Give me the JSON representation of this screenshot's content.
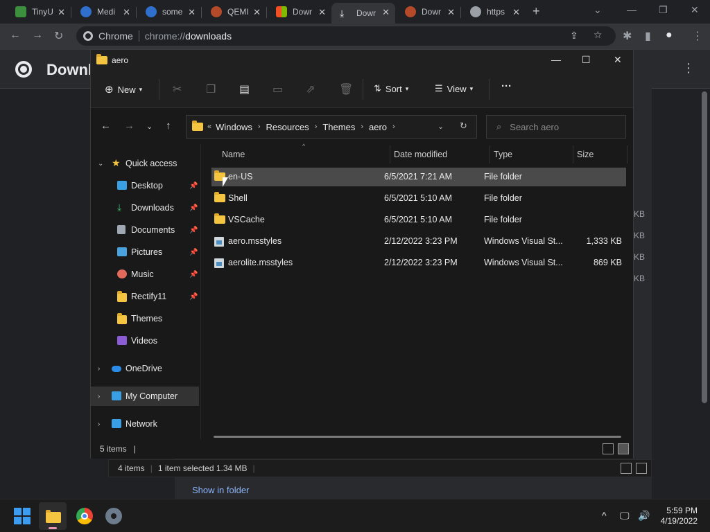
{
  "chrome": {
    "tabs": [
      {
        "title": "TinyU",
        "icon_color": "#3c8f3c"
      },
      {
        "title": "Medi",
        "icon_color": "#2f6fce"
      },
      {
        "title": "some",
        "icon_color": "#2f6fce"
      },
      {
        "title": "QEMI",
        "icon_color": "#b54a2b"
      },
      {
        "title": "Dowr",
        "icon_color": "#e04a2b"
      },
      {
        "title": "Dowr",
        "icon_color": "#e8eaed"
      },
      {
        "title": "Dowr",
        "icon_color": "#b54a2b"
      },
      {
        "title": "https",
        "icon_color": "#9aa0a6"
      }
    ],
    "new_tab": "+",
    "omnibox": {
      "chip": "Chrome",
      "url_scheme": "chrome://",
      "url_path": "downloads"
    }
  },
  "downloads_page": {
    "title": "Downl",
    "sizes": [
      "KB",
      "KB",
      "KB",
      "KB"
    ],
    "show_in_folder": "Show in folder",
    "behind_status": {
      "items": "4 items",
      "selected": "1 item selected  1.34 MB"
    }
  },
  "explorer": {
    "title": "aero",
    "toolbar": {
      "new": "New",
      "sort": "Sort",
      "view": "View",
      "more": "···"
    },
    "breadcrumb": [
      "Windows",
      "Resources",
      "Themes",
      "aero"
    ],
    "search_placeholder": "Search aero",
    "nav": {
      "quick_access": "Quick access",
      "items": [
        {
          "label": "Desktop",
          "icon": "desktop-icon",
          "color": "#3aa0e6",
          "pinned": true
        },
        {
          "label": "Downloads",
          "icon": "download-icon",
          "color": "#3ab66a",
          "pinned": true
        },
        {
          "label": "Documents",
          "icon": "document-icon",
          "color": "#9fa8b3",
          "pinned": true
        },
        {
          "label": "Pictures",
          "icon": "picture-icon",
          "color": "#4aa3df",
          "pinned": true
        },
        {
          "label": "Music",
          "icon": "music-icon",
          "color": "#e26a5b",
          "pinned": true
        },
        {
          "label": "Rectify11",
          "icon": "folder-icon",
          "color": "#f5c542",
          "pinned": true
        },
        {
          "label": "Themes",
          "icon": "folder-icon",
          "color": "#f5c542",
          "pinned": false
        },
        {
          "label": "Videos",
          "icon": "video-icon",
          "color": "#8b5cd6",
          "pinned": false
        }
      ],
      "onedrive": "OneDrive",
      "my_computer": "My Computer",
      "network": "Network"
    },
    "columns": {
      "name": "Name",
      "date": "Date modified",
      "type": "Type",
      "size": "Size"
    },
    "files": [
      {
        "name": "en-US",
        "date": "6/5/2021 7:21 AM",
        "type": "File folder",
        "size": "",
        "kind": "folder"
      },
      {
        "name": "Shell",
        "date": "6/5/2021 5:10 AM",
        "type": "File folder",
        "size": "",
        "kind": "folder"
      },
      {
        "name": "VSCache",
        "date": "6/5/2021 5:10 AM",
        "type": "File folder",
        "size": "",
        "kind": "folder"
      },
      {
        "name": "aero.msstyles",
        "date": "2/12/2022 3:23 PM",
        "type": "Windows Visual St...",
        "size": "1,333 KB",
        "kind": "file"
      },
      {
        "name": "aerolite.msstyles",
        "date": "2/12/2022 3:23 PM",
        "type": "Windows Visual St...",
        "size": "869 KB",
        "kind": "file"
      }
    ],
    "status": "5 items"
  },
  "taskbar": {
    "time": "5:59 PM",
    "date": "4/19/2022"
  }
}
